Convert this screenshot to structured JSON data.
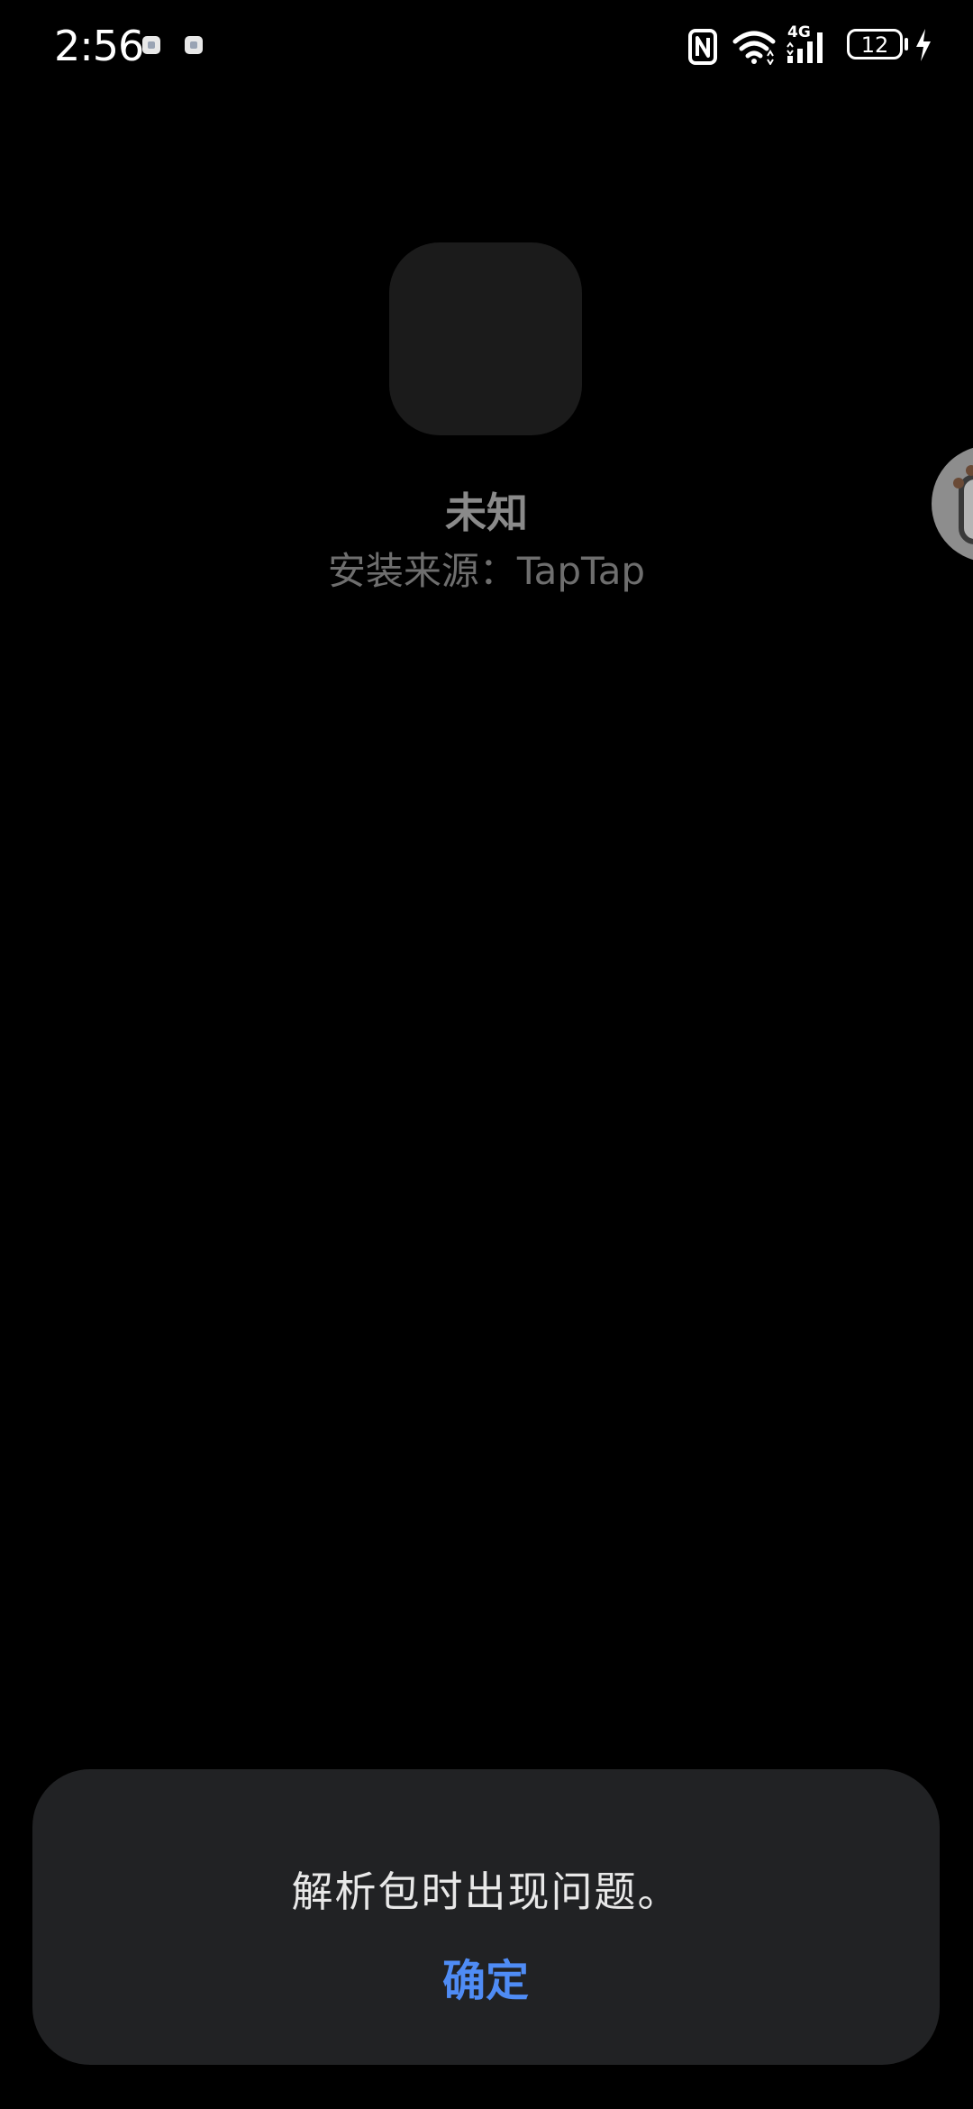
{
  "status_bar": {
    "time": "2:56",
    "network_type": "4G",
    "battery_level": "12",
    "icons": [
      "notification-icon",
      "notification-icon",
      "nfc-icon",
      "wifi-icon",
      "signal-icon",
      "battery-icon",
      "charging-icon"
    ]
  },
  "app": {
    "name": "未知",
    "install_source": "安装来源：TapTap"
  },
  "dialog": {
    "message": "解析包时出现问题。",
    "confirm_label": "确定",
    "confirm_color": "#4f8cf5"
  }
}
